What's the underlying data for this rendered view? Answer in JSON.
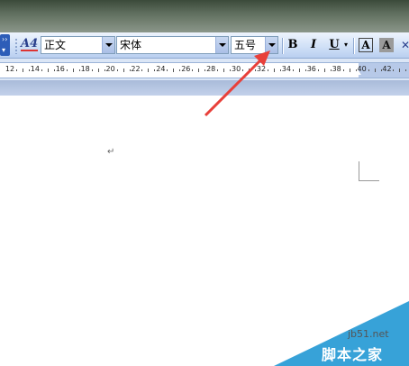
{
  "toolbar": {
    "style_value": "正文",
    "font_value": "宋体",
    "size_value": "五号",
    "bold_label": "B",
    "italic_label": "I",
    "underline_label": "U",
    "border_a_label": "A",
    "shade_a_label": "A",
    "style_icon_label": "A4"
  },
  "ruler": {
    "numbers": [
      "12",
      "14",
      "16",
      "18",
      "20",
      "22",
      "24",
      "26",
      "28",
      "30",
      "32",
      "34",
      "36",
      "38",
      "40",
      "42"
    ]
  },
  "document": {
    "paragraph_mark": "↵"
  },
  "watermark": {
    "site": "jb51.net",
    "brand": "脚本之家"
  },
  "annotation": {
    "arrow_color": "#e8403a"
  }
}
